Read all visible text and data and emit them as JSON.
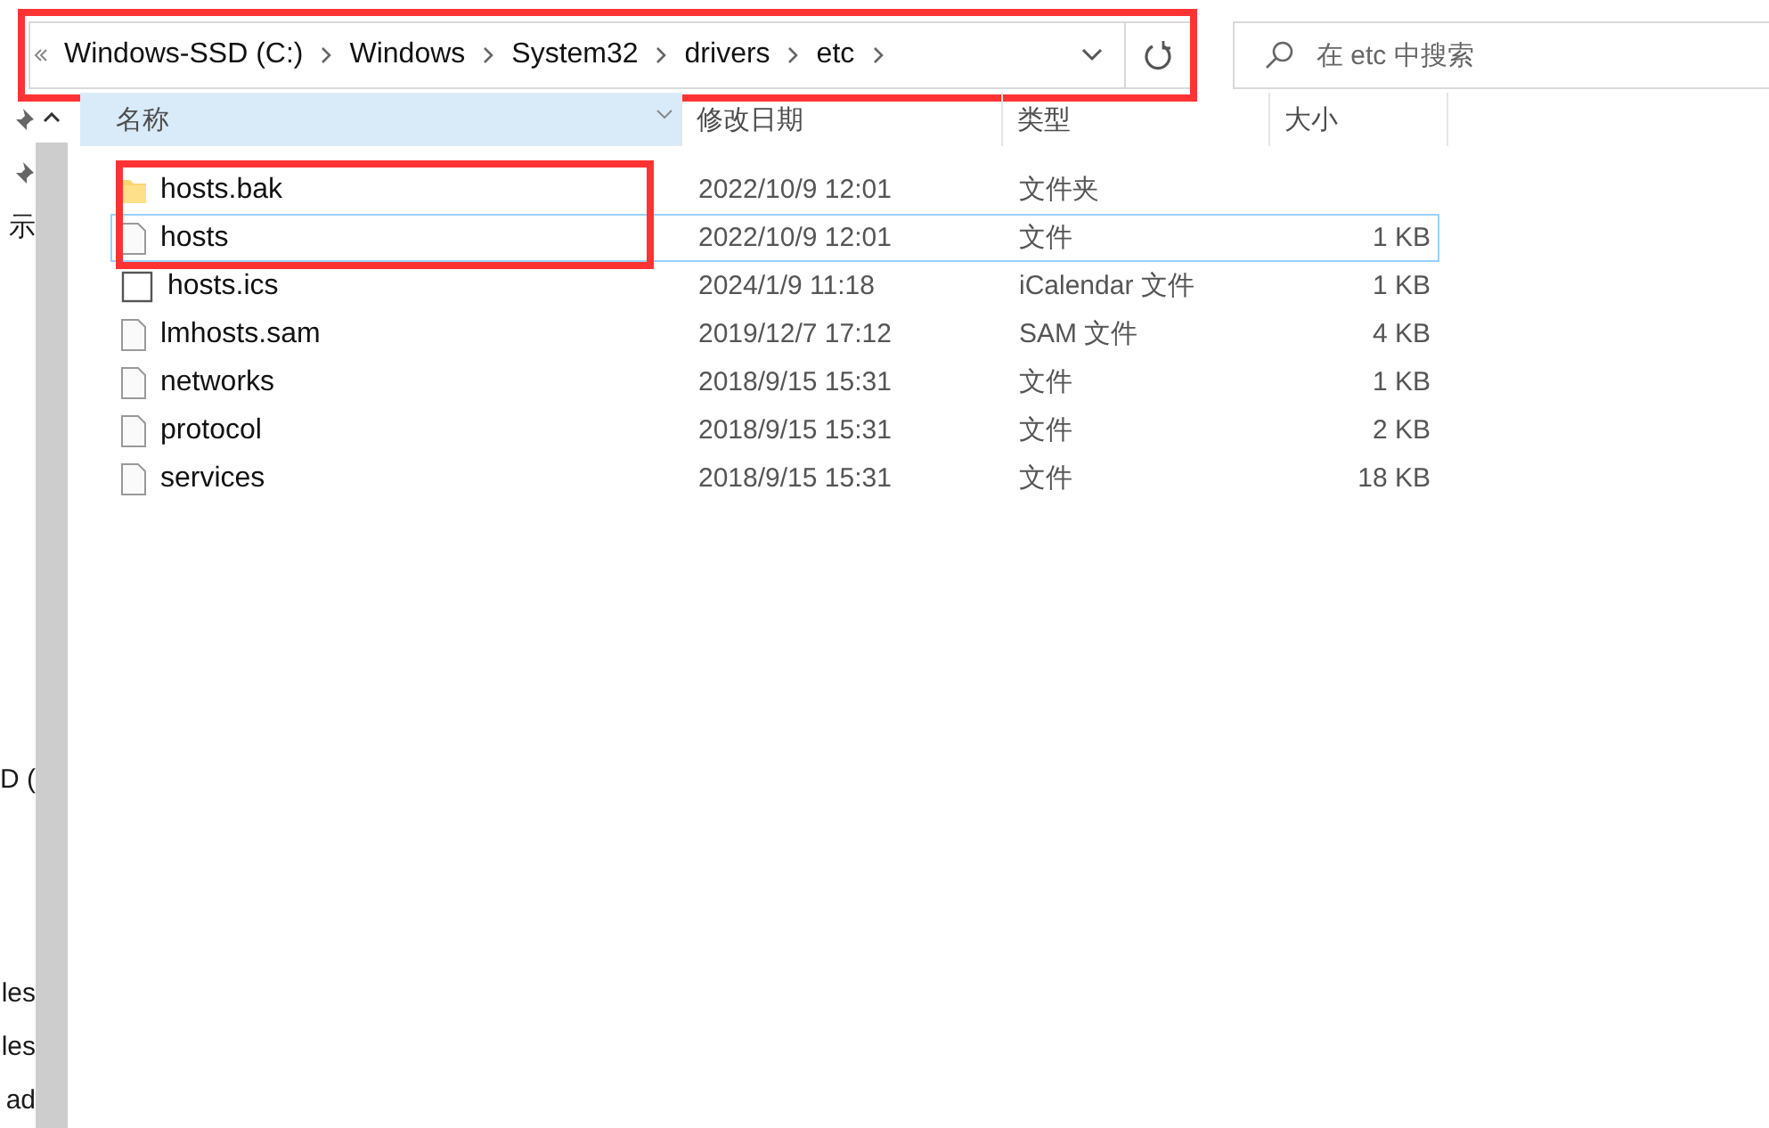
{
  "address_bar": {
    "highlighted": true,
    "crumbs": [
      "Windows-SSD (C:)",
      "Windows",
      "System32",
      "drivers",
      "etc"
    ]
  },
  "search": {
    "placeholder": "在 etc 中搜索"
  },
  "nav_pane": [
    {
      "kind": "pin"
    },
    {
      "kind": "pin"
    },
    {
      "kind": "label",
      "text": "示"
    },
    {
      "kind": "label",
      "text": "D ("
    },
    {
      "kind": "label",
      "text": "les"
    },
    {
      "kind": "label",
      "text": "les"
    },
    {
      "kind": "label",
      "text": "ad"
    }
  ],
  "table": {
    "columns": [
      {
        "label": "名称",
        "sorted": true
      },
      {
        "label": "修改日期",
        "sorted": false
      },
      {
        "label": "类型",
        "sorted": false
      },
      {
        "label": "大小",
        "sorted": false
      }
    ],
    "rows": [
      {
        "kind": "folder",
        "name": "hosts.bak",
        "date": "2022/10/9 12:01",
        "type": "文件夹",
        "highlighted": true,
        "focused": false
      },
      {
        "kind": "file",
        "name": "hosts",
        "date": "2022/10/9 12:01",
        "type": "文件",
        "size": "1 KB",
        "highlighted": true,
        "focused": true
      },
      {
        "kind": "calendar",
        "name": "hosts.ics",
        "date": "2024/1/9 11:18",
        "type": "iCalendar 文件",
        "size": "1 KB",
        "highlighted": false,
        "focused": false
      },
      {
        "kind": "file",
        "name": "lmhosts.sam",
        "date": "2019/12/7 17:12",
        "type": "SAM 文件",
        "size": "4 KB",
        "highlighted": false,
        "focused": false
      },
      {
        "kind": "file",
        "name": "networks",
        "date": "2018/9/15 15:31",
        "type": "文件",
        "size": "1 KB",
        "highlighted": false,
        "focused": false
      },
      {
        "kind": "file",
        "name": "protocol",
        "date": "2018/9/15 15:31",
        "type": "文件",
        "size": "2 KB",
        "highlighted": false,
        "focused": false
      },
      {
        "kind": "file",
        "name": "services",
        "date": "2018/9/15 15:31",
        "type": "文件",
        "size": "18 KB",
        "highlighted": false,
        "focused": false
      }
    ]
  }
}
